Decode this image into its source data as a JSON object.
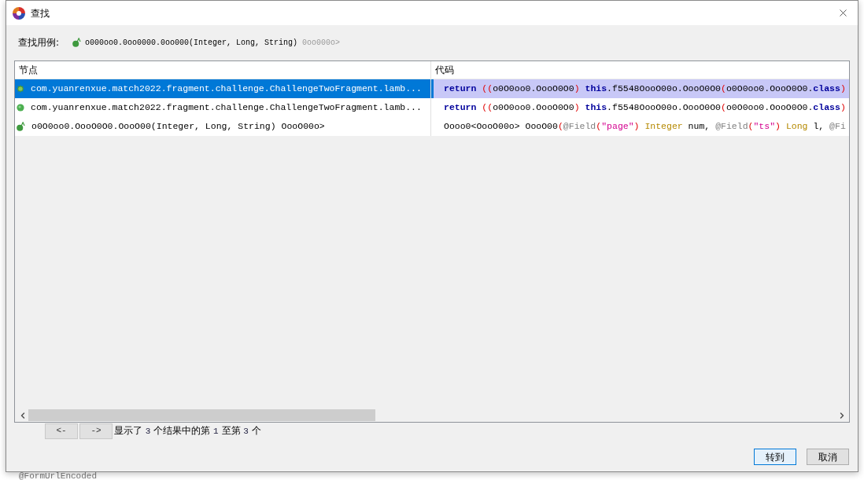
{
  "window": {
    "title": "查找"
  },
  "search_for": {
    "label": "查找用例:",
    "kind": "abstract",
    "text": "o000oo0.0oo0000.0oo000(Integer, Long, String)",
    "suffix": "0oo000o>"
  },
  "table": {
    "columns": [
      "节点",
      "代码"
    ],
    "rows": [
      {
        "selected": true,
        "kind": "lambda",
        "node": "com.yuanrenxue.match2022.fragment.challenge.ChallengeTwoFragment.lamb...",
        "code": [
          {
            "kind": "keyword",
            "text": "return"
          },
          {
            "kind": "paren",
            "text": " (("
          },
          {
            "kind": "plain",
            "text": "o0O0oo0.OooO0O0"
          },
          {
            "kind": "paren",
            "text": ")"
          },
          {
            "kind": "keyword",
            "text": " this"
          },
          {
            "kind": "plain",
            "text": ".f5548OooO00o.OooO0O0"
          },
          {
            "kind": "paren",
            "text": "("
          },
          {
            "kind": "plain",
            "text": "o0O0oo0.OooO0O0."
          },
          {
            "kind": "keyword",
            "text": "class"
          },
          {
            "kind": "paren",
            "text": ")"
          }
        ]
      },
      {
        "selected": false,
        "kind": "method",
        "node": "com.yuanrenxue.match2022.fragment.challenge.ChallengeTwoFragment.lamb...",
        "code": [
          {
            "kind": "keyword",
            "text": "return"
          },
          {
            "kind": "paren",
            "text": " (("
          },
          {
            "kind": "plain",
            "text": "o0O0oo0.OooO0O0"
          },
          {
            "kind": "paren",
            "text": ")"
          },
          {
            "kind": "keyword",
            "text": " this"
          },
          {
            "kind": "plain",
            "text": ".f5548OooO00o.OooO0O0"
          },
          {
            "kind": "paren",
            "text": "("
          },
          {
            "kind": "plain",
            "text": "o0O0oo0.OooO0O0."
          },
          {
            "kind": "keyword",
            "text": "class"
          },
          {
            "kind": "paren",
            "text": ")"
          }
        ]
      },
      {
        "selected": false,
        "kind": "abstract",
        "node": "o0O0oo0.OooO0O0.OooO00(Integer, Long, String)",
        "node_suffix": "OooO00o>",
        "code": [
          {
            "kind": "plain",
            "text": "Oooo0<OooO00o> OooO00"
          },
          {
            "kind": "paren",
            "text": "("
          },
          {
            "kind": "annotation",
            "text": "@Field"
          },
          {
            "kind": "paren",
            "text": "("
          },
          {
            "kind": "string",
            "text": "\"page\""
          },
          {
            "kind": "paren",
            "text": ")"
          },
          {
            "kind": "type",
            "text": " Integer"
          },
          {
            "kind": "plain",
            "text": " num, "
          },
          {
            "kind": "annotation",
            "text": "@Field"
          },
          {
            "kind": "paren",
            "text": "("
          },
          {
            "kind": "string",
            "text": "\"ts\""
          },
          {
            "kind": "paren",
            "text": ")"
          },
          {
            "kind": "type",
            "text": " Long"
          },
          {
            "kind": "plain",
            "text": " l, "
          },
          {
            "kind": "annotation",
            "text": "@Fi"
          }
        ]
      }
    ]
  },
  "pager": {
    "buttons": [
      "<-",
      "->"
    ],
    "status": [
      {
        "kind": "text",
        "text": "显示了 "
      },
      {
        "kind": "number",
        "text": "3"
      },
      {
        "kind": "text",
        "text": " 个结果中的第 "
      },
      {
        "kind": "number",
        "text": "1"
      },
      {
        "kind": "text",
        "text": " 至第 "
      },
      {
        "kind": "number",
        "text": "3"
      },
      {
        "kind": "text",
        "text": " 个"
      }
    ]
  },
  "buttons": [
    {
      "label": "转到",
      "default": true
    },
    {
      "label": "取消",
      "default": false
    }
  ],
  "background": {
    "editor_lines": [
      "@FormUrlEncoded"
    ]
  }
}
